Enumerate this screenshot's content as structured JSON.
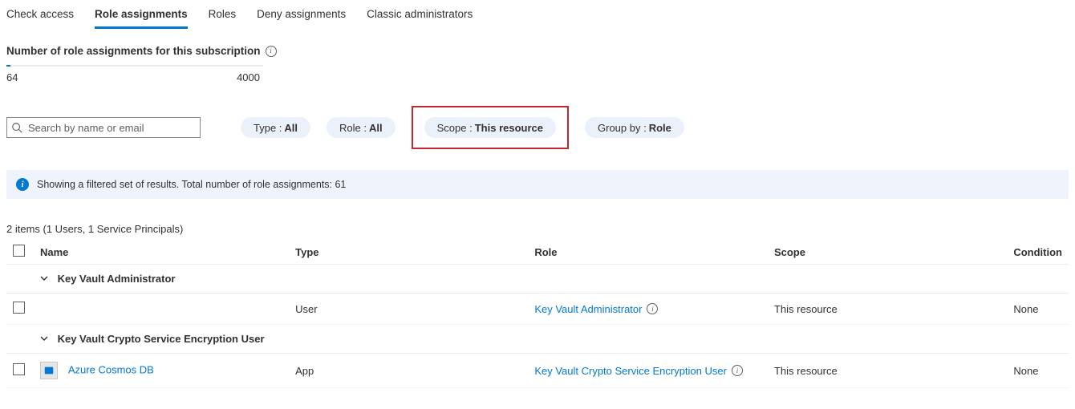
{
  "tabs": {
    "check_access": "Check access",
    "role_assignments": "Role assignments",
    "roles": "Roles",
    "deny_assignments": "Deny assignments",
    "classic_admins": "Classic administrators"
  },
  "subscription_count": {
    "label": "Number of role assignments for this subscription",
    "current": "64",
    "max": "4000"
  },
  "search": {
    "placeholder": "Search by name or email"
  },
  "filters": {
    "type": {
      "label": "Type :",
      "value": "All"
    },
    "role": {
      "label": "Role :",
      "value": "All"
    },
    "scope": {
      "label": "Scope :",
      "value": "This resource"
    },
    "group_by": {
      "label": "Group by :",
      "value": "Role"
    }
  },
  "banner": "Showing a filtered set of results. Total number of role assignments: 61",
  "summary": "2 items (1 Users, 1 Service Principals)",
  "columns": {
    "name": "Name",
    "type": "Type",
    "role": "Role",
    "scope": "Scope",
    "condition": "Condition"
  },
  "groups": [
    {
      "title": "Key Vault Administrator",
      "rows": [
        {
          "name": "",
          "type": "User",
          "role": "Key Vault Administrator",
          "scope": "This resource",
          "condition": "None"
        }
      ]
    },
    {
      "title": "Key Vault Crypto Service Encryption User",
      "rows": [
        {
          "name": "Azure Cosmos DB",
          "type": "App",
          "role": "Key Vault Crypto Service Encryption User",
          "scope": "This resource",
          "condition": "None"
        }
      ]
    }
  ]
}
